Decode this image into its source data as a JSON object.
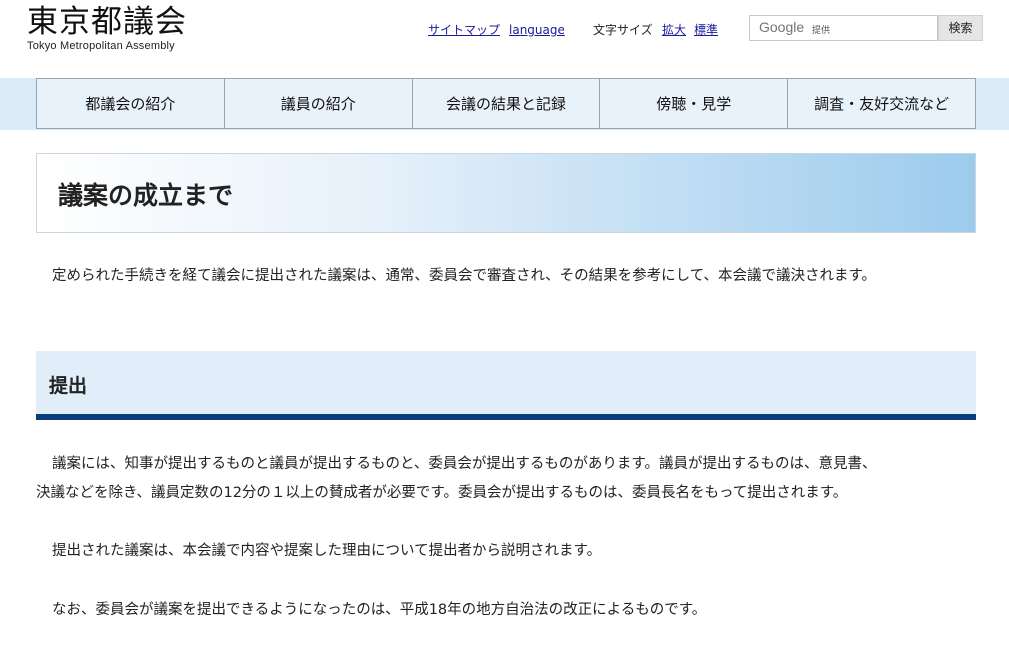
{
  "header": {
    "logo_title": "東京都議会",
    "logo_subtitle": "Tokyo Metropolitan Assembly",
    "sitemap": "サイトマップ",
    "language": "language",
    "font_size_label": "文字サイズ",
    "enlarge": "拡大",
    "standard": "標準",
    "search": {
      "google": "Google",
      "provided": "提供",
      "button": "検索"
    }
  },
  "nav": {
    "items": [
      {
        "label": "都議会の紹介"
      },
      {
        "label": "議員の紹介"
      },
      {
        "label": "会議の結果と記録"
      },
      {
        "label": "傍聴・見学"
      },
      {
        "label": "調査・友好交流など"
      }
    ]
  },
  "main": {
    "page_title": "議案の成立まで",
    "intro": "定められた手続きを経て議会に提出された議案は、通常、委員会で審査され、その結果を参考にして、本会議で議決されます。",
    "section_title": "提出",
    "paragraphs": [
      "議案には、知事が提出するものと議員が提出するものと、委員会が提出するものがあります。議員が提出するものは、意見書、",
      "決議などを除き、議員定数の12分の１以上の賛成者が必要です。委員会が提出するものは、委員長名をもって提出されます。",
      "提出された議案は、本会議で内容や提案した理由について提出者から説明されます。",
      "なお、委員会が議案を提出できるようになったのは、平成18年の地方自治法の改正によるものです。"
    ]
  },
  "colors": {
    "nav_band": "#dcebf8",
    "section_bar": "#0a3d7e",
    "title_gradient_end": "#9ccbed",
    "link": "#1a1a9a"
  }
}
